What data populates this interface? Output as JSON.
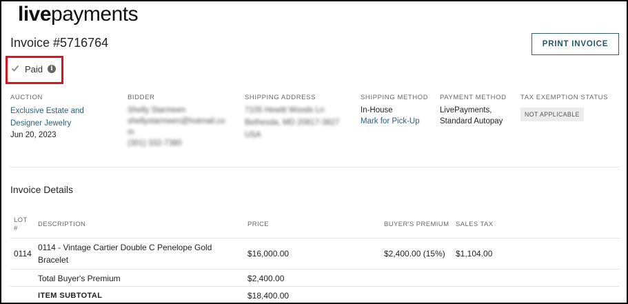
{
  "brand": {
    "logo_bold": "live",
    "logo_light": "payments"
  },
  "invoice": {
    "title": "Invoice #5716764",
    "print_label": "PRINT INVOICE"
  },
  "status": {
    "paid_label": "Paid",
    "info_glyph": "i",
    "checked": true
  },
  "info": {
    "auction": {
      "label": "AUCTION",
      "name_line1": "Exclusive Estate and",
      "name_line2": "Designer Jewelry",
      "date": "Jun 20, 2023"
    },
    "bidder": {
      "label": "BIDDER",
      "line1": "Shelly Starmeen",
      "line2": "shellystarmeen@hotmail.co",
      "line3": "m",
      "line4": "(301) 332-7380"
    },
    "shipping_address": {
      "label": "SHIPPING ADDRESS",
      "line1": "7105 Hewitt Woods Ln",
      "line2": "Bethesda, MD 20817-3827",
      "line3": "USA"
    },
    "shipping_method": {
      "label": "SHIPPING METHOD",
      "value": "In-House",
      "link": "Mark for Pick-Up"
    },
    "payment_method": {
      "label": "PAYMENT METHOD",
      "line1": "LivePayments,",
      "line2": "Standard Autopay"
    },
    "tax_status": {
      "label": "TAX EXEMPTION STATUS",
      "badge": "NOT APPLICABLE"
    }
  },
  "details": {
    "title": "Invoice Details",
    "columns": {
      "lot_line1": "LOT",
      "lot_line2": "#",
      "description": "DESCRIPTION",
      "price": "PRICE",
      "premium": "BUYER'S PREMIUM",
      "tax": "SALES TAX"
    },
    "rows": [
      {
        "lot": "0114",
        "desc_line1": "0114 - Vintage Cartier Double C Penelope Gold",
        "desc_line2": "Bracelet",
        "price": "$16,000.00",
        "premium": "$2,400.00 (15%)",
        "tax": "$1,104.00"
      }
    ],
    "totals": [
      {
        "label": "Total Buyer's Premium",
        "value": "$2,400.00"
      },
      {
        "label": "ITEM SUBTOTAL",
        "value": "$18,400.00"
      }
    ]
  },
  "colors": {
    "accent": "#2a6079",
    "highlight_border": "#e0131a"
  }
}
